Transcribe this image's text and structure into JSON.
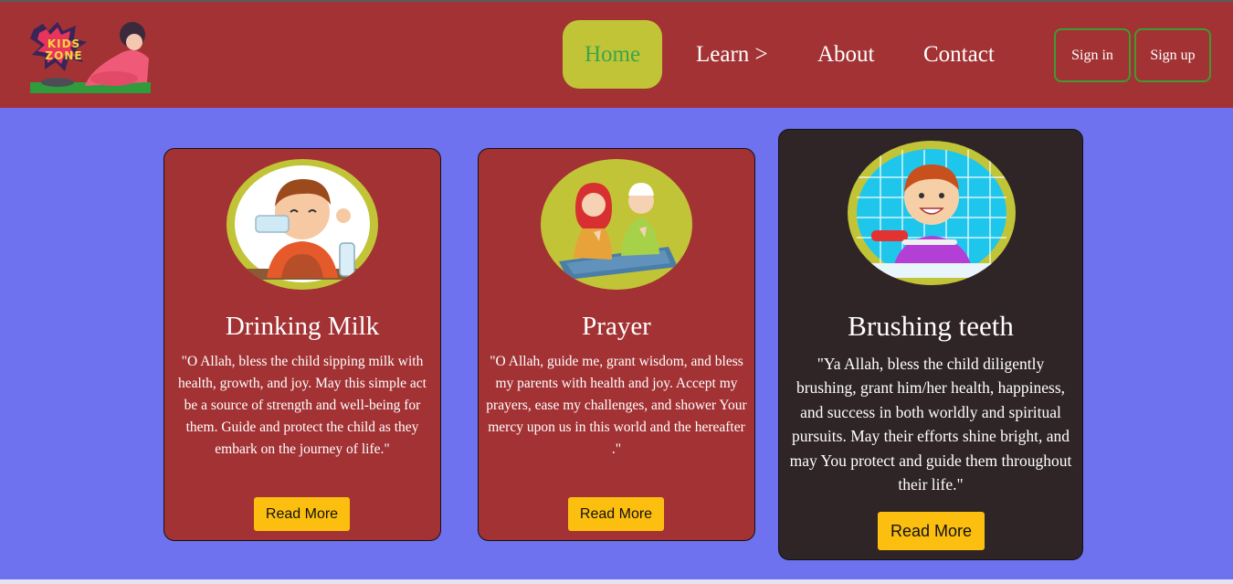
{
  "header": {
    "logo_text": "KIDS ZONE",
    "nav": [
      {
        "label": "Home",
        "active": true
      },
      {
        "label": "Learn >",
        "active": false
      },
      {
        "label": "About",
        "active": false
      },
      {
        "label": "Contact",
        "active": false
      }
    ],
    "sign_in_label": "Sign in",
    "sign_up_label": "Sign up"
  },
  "cards": [
    {
      "title": "Drinking Milk",
      "text": "\"O Allah, bless the child sipping milk with health, growth, and joy. May this simple act be a source of strength and well-being for them. Guide and protect the child as they embark on the journey of life.\"",
      "button": "Read More"
    },
    {
      "title": "Prayer",
      "text": "\"O Allah, guide me, grant wisdom, and bless my parents with health and joy. Accept my prayers, ease my challenges, and shower Your mercy upon us in this world and the hereafter .\"",
      "button": "Read More"
    },
    {
      "title": "Brushing teeth",
      "text": "\"Ya Allah, bless the child diligently brushing, grant him/her health, happiness, and success in both worldly and spiritual pursuits. May their efforts shine bright, and may You protect and guide them throughout their life.\"",
      "button": "Read More"
    }
  ],
  "colors": {
    "header_bg": "#a33234",
    "page_bg": "#6f72ef",
    "highlight": "#c2c438",
    "nav_active_text": "#3aa64a",
    "button_yellow": "#fdbf0f",
    "dark_card": "#2f2527"
  }
}
